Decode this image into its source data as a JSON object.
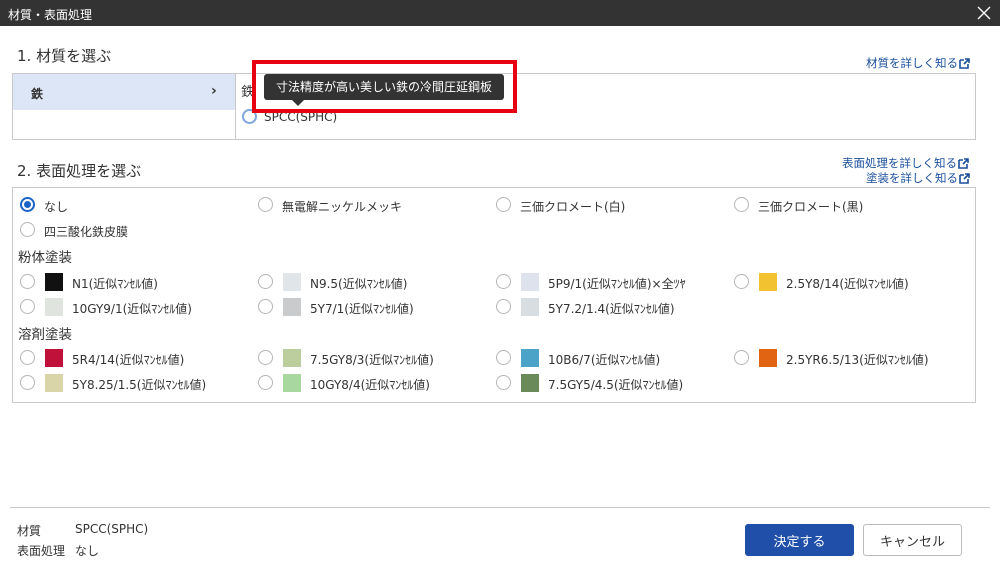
{
  "window": {
    "title": "材質・表面処理"
  },
  "material": {
    "heading": "1. 材質を選ぶ",
    "detail_link": "材質を詳しく知る",
    "categories": [
      {
        "label": "鉄",
        "selected": true
      }
    ],
    "group_label": "鉄",
    "options": [
      {
        "label": "SPCC(SPHC)",
        "selected": true
      }
    ],
    "tooltip": "寸法精度が高い美しい鉄の冷間圧延鋼板"
  },
  "surface": {
    "heading": "2. 表面処理を選ぶ",
    "detail_link": "表面処理を詳しく知る",
    "paint_link": "塗装を詳しく知る",
    "plain_options": [
      {
        "label": "なし",
        "selected": true
      },
      {
        "label": "無電解ニッケルメッキ",
        "selected": false
      },
      {
        "label": "三価クロメート(白)",
        "selected": false
      },
      {
        "label": "三価クロメート(黒)",
        "selected": false
      },
      {
        "label": "四三酸化鉄皮膜",
        "selected": false
      }
    ],
    "powder": {
      "label": "粉体塗装",
      "options": [
        {
          "label": "N1(近似ﾏﾝｾﾙ値)",
          "color": "#111111"
        },
        {
          "label": "N9.5(近似ﾏﾝｾﾙ値)",
          "color": "#e0e5ea"
        },
        {
          "label": "5P9/1(近似ﾏﾝｾﾙ値)×全ﾂﾔ",
          "color": "#dde2ec"
        },
        {
          "label": "2.5Y8/14(近似ﾏﾝｾﾙ値)",
          "color": "#f2c230"
        },
        {
          "label": "10GY9/1(近似ﾏﾝｾﾙ値)",
          "color": "#dfe4df"
        },
        {
          "label": "5Y7/1(近似ﾏﾝｾﾙ値)",
          "color": "#cacbcd"
        },
        {
          "label": "5Y7.2/1.4(近似ﾏﾝｾﾙ値)",
          "color": "#d8dde2"
        }
      ]
    },
    "solvent": {
      "label": "溶剤塗装",
      "options": [
        {
          "label": "5R4/14(近似ﾏﾝｾﾙ値)",
          "color": "#c0113a"
        },
        {
          "label": "7.5GY8/3(近似ﾏﾝｾﾙ値)",
          "color": "#bccd9e"
        },
        {
          "label": "10B6/7(近似ﾏﾝｾﾙ値)",
          "color": "#4ba3c8"
        },
        {
          "label": "2.5YR6.5/13(近似ﾏﾝｾﾙ値)",
          "color": "#e06412"
        },
        {
          "label": "5Y8.25/1.5(近似ﾏﾝｾﾙ値)",
          "color": "#dad5a8"
        },
        {
          "label": "10GY8/4(近似ﾏﾝｾﾙ値)",
          "color": "#a8d8a0"
        },
        {
          "label": "7.5GY5/4.5(近似ﾏﾝｾﾙ値)",
          "color": "#6a8a5a"
        }
      ]
    }
  },
  "summary": {
    "material_label": "材質",
    "material_value": "SPCC(SPHC)",
    "surface_label": "表面処理",
    "surface_value": "なし"
  },
  "buttons": {
    "ok": "決定する",
    "cancel": "キャンセル"
  },
  "colors": {
    "accent": "#1a64c8",
    "primary_button": "#1f4fa8",
    "highlight": "#e60012",
    "link": "#1a4f9c"
  }
}
